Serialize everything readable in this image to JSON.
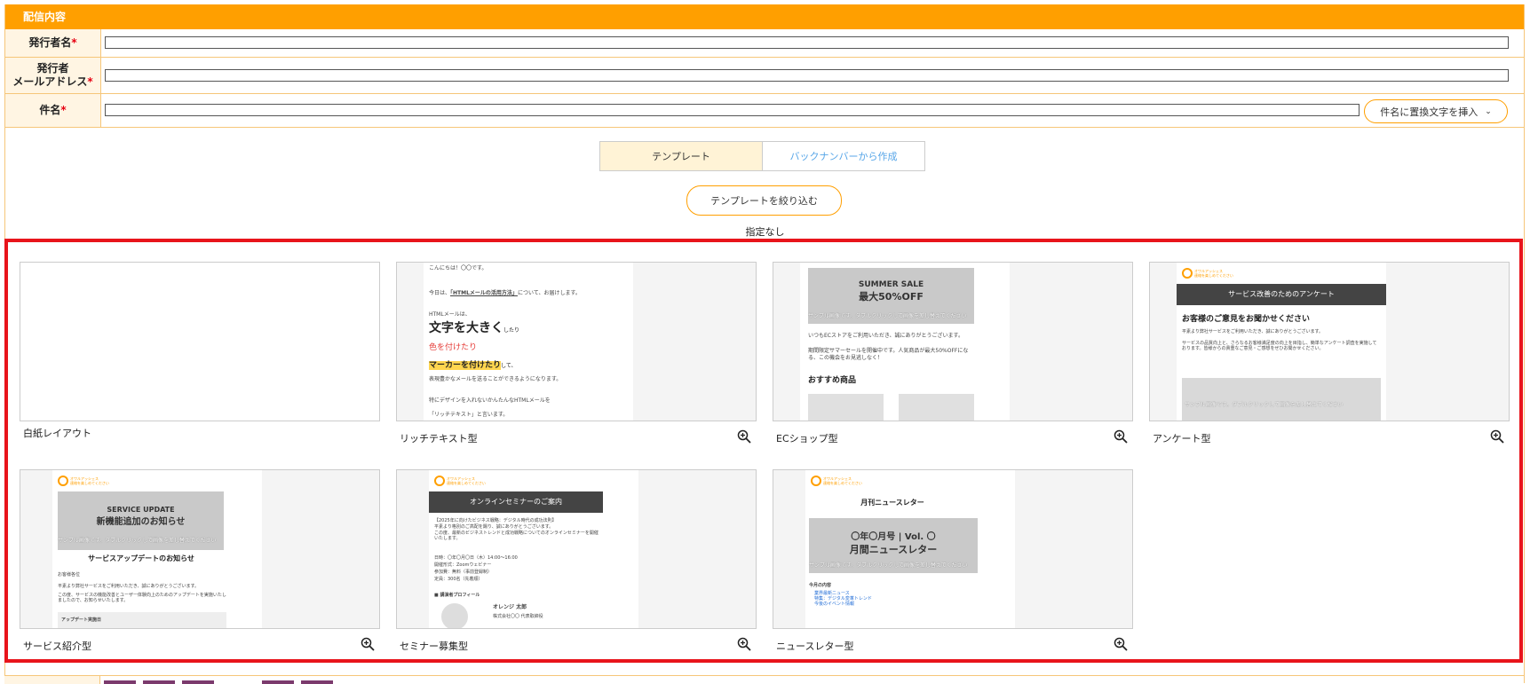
{
  "section": {
    "title": "配信内容"
  },
  "form": {
    "sender_name_label": "発行者名",
    "sender_email_label_line1": "発行者",
    "sender_email_label_line2": "メールアドレス",
    "subject_label": "件名",
    "required_mark": "*",
    "insert_button_label": "件名に置換文字を挿入"
  },
  "tabs": [
    {
      "label": "テンプレート",
      "active": true
    },
    {
      "label": "バックナンバーから作成",
      "active": false
    }
  ],
  "filter": {
    "button_label": "テンプレートを絞り込む",
    "status": "指定なし"
  },
  "templates": [
    {
      "label": "白紙レイアウト"
    },
    {
      "label": "リッチテキスト型"
    },
    {
      "label": "ECショップ型"
    },
    {
      "label": "アンケート型"
    },
    {
      "label": "サービス紹介型"
    },
    {
      "label": "セミナー募集型"
    },
    {
      "label": "ニュースレター型"
    }
  ],
  "previews": {
    "rich": {
      "l1": "こんにちは！〇〇です。",
      "l2a": "今日は、",
      "l2b": "「HTMLメールの活用方法」",
      "l2c": "について、お届けします。",
      "l3": "HTMLメールは、",
      "big": "文字を大きく",
      "big_suffix": "したり",
      "red": "色を付けたり",
      "marker": "マーカーを付けたり",
      "marker_suffix": "して、",
      "l4": "表現豊かなメールを送ることができるようになります。",
      "l5": "特にデザインを入れないかんたんなHTMLメールを",
      "l6": "「リッチテキスト」と言います。"
    },
    "ec": {
      "sale1": "SUMMER SALE",
      "sale2": "最大50%OFF",
      "watermark": "サンプル画像です。ダブルクリックして画像を差し替えてください",
      "p1": "いつもECストアをご利用いただき、誠にありがとうございます。",
      "p2": "期間限定サマーセールを開催中です。人気商品が最大50%OFFになる、この機会をお見逃しなく！",
      "heading": "おすすめ商品"
    },
    "survey": {
      "band": "サービス改善のためのアンケート",
      "heading": "お客様のご意見をお聞かせください",
      "p1": "平素より弊社サービスをご利用いただき、誠にありがとうございます。",
      "p2": "サービスの品質向上と、さらなるお客様満足度の向上を目指し、簡単なアンケート調査を実施しております。皆様からの貴重なご意見・ご感想をぜひお聞かせください。",
      "watermark": "サンプル画像です。ダブルクリックして画像を差し替えてください"
    },
    "service": {
      "banner1": "SERVICE UPDATE",
      "banner2": "新機能追加のお知らせ",
      "watermark": "サンプル画像です。ダブルクリックして画像を差し替えてください",
      "heading": "サービスアップデートのお知らせ",
      "greeting": "お客様各位",
      "p1": "平素より弊社サービスをご利用いただき、誠にありがとうございます。",
      "p2": "この度、サービスの機能改善とユーザー体験向上のためのアップデートを実施いたしましたので、お知らせいたします。",
      "box": "アップデート実施日"
    },
    "seminar": {
      "band": "オンラインセミナーのご案内",
      "p1": "【2025年に向けたビジネス戦略：デジタル時代の成功法則】",
      "p2": "平素より格別のご高配を賜り、誠にありがとうございます。",
      "p3": "この度、最新のビジネストレンドと成功戦略についてのオンラインセミナーを開催いたします。",
      "d1": "日時：〇年〇月〇日（木）14:00〜16:00",
      "d2": "開催形式：Zoomウェビナー",
      "d3": "参加費：無料（事前登録制）",
      "d4": "定員：300名（先着順）",
      "speaker_heading": "■ 講演者プロフィール",
      "speaker_name": "オレンジ 太郎",
      "speaker_org": "株式会社〇〇 代表取締役"
    },
    "news": {
      "title": "月刊ニュースレター",
      "banner1": "〇年〇月号 | Vol. 〇",
      "banner2": "月間ニュースレター",
      "watermark": "サンプル画像です。ダブルクリックして画像を差し替えてください",
      "toc_heading": "今月の内容",
      "toc": [
        "業界最新ニュース",
        "特集：デジタル変革トレンド",
        "今後のイベント情報"
      ]
    },
    "logo": {
      "line1": "オワルアッシェス",
      "line2": "連絡を楽しめてください"
    }
  },
  "colors": {
    "accent": "#ff9f00",
    "highlight_border": "#e8141b",
    "link": "#58a6e8"
  }
}
